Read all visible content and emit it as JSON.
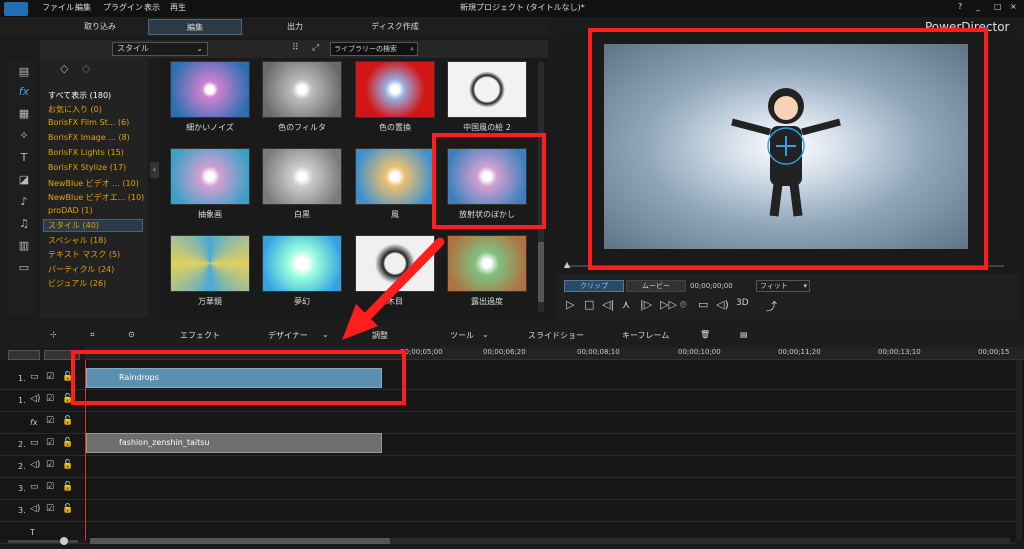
{
  "app": {
    "title": "新規プロジェクト (タイトルなし)*",
    "brand": "PowerDirector"
  },
  "menu": [
    "ファイル",
    "編集",
    "プラグイン",
    "表示",
    "再生"
  ],
  "window_controls": [
    "?",
    "_",
    "□",
    "×"
  ],
  "main_tabs": [
    "取り込み",
    "編集",
    "出力",
    "ディスク作成"
  ],
  "library": {
    "dropdown": "スタイル",
    "search_placeholder": "ライブラリーの検索"
  },
  "categories": [
    {
      "label": "すべて表示 (180)",
      "color": "#ffffff"
    },
    {
      "label": "お気に入り (0)"
    },
    {
      "label": "BorisFX Film St... (6)"
    },
    {
      "label": "BorisFX Image ... (8)"
    },
    {
      "label": "BorisFX Lights (15)"
    },
    {
      "label": "BorisFX Stylize (17)"
    },
    {
      "label": "NewBlue ビデオ ... (10)"
    },
    {
      "label": "NewBlue ビデオエ... (10)"
    },
    {
      "label": "proDAD (1)"
    },
    {
      "label": "スタイル (40)",
      "selected": true
    },
    {
      "label": "スペシャル (18)"
    },
    {
      "label": "テキスト マスク (5)"
    },
    {
      "label": "パーティクル (24)"
    },
    {
      "label": "ビジュアル (26)"
    }
  ],
  "effects": [
    {
      "label": "細かいノイズ",
      "bg": "#2a6fb0"
    },
    {
      "label": "色のフィルタ",
      "bg": "#6a6a6a"
    },
    {
      "label": "色の置換",
      "bg": "#d21515"
    },
    {
      "label": "中国風の絵 2",
      "bg": "#f2f2f2"
    },
    {
      "label": "抽象画",
      "bg": "#3aa0c8"
    },
    {
      "label": "白黒",
      "bg": "#7a7a7a"
    },
    {
      "label": "風",
      "bg": "#3c8fd0"
    },
    {
      "label": "放射状のぼかし",
      "bg": "#3d7fc0"
    },
    {
      "label": "万華鏡",
      "bg": "#4aa8d8"
    },
    {
      "label": "夢幻",
      "bg": "#35a2e0"
    },
    {
      "label": "木目",
      "bg": "#f0f0f0"
    },
    {
      "label": "露出過度",
      "bg": "#b07040"
    }
  ],
  "preview_controls": {
    "clip": "クリップ",
    "movie": "ムービー",
    "timecode": "00;00;00;00",
    "fit": "フィット",
    "mode3d": "3D"
  },
  "timeline_toolbar": [
    "エフェクト",
    "デザイナー",
    "調整",
    "ツール",
    "スライドショー",
    "キーフレーム"
  ],
  "ruler_ticks": [
    "00;00;05;00",
    "00;00;06;20",
    "00;00;08;10",
    "00;00;10;00",
    "00;00;11;20",
    "00;00;13;10",
    "00;00;15"
  ],
  "tracks": [
    {
      "label": "1."
    },
    {
      "label": "1."
    },
    {
      "label": "fx"
    },
    {
      "label": "2."
    },
    {
      "label": "2."
    },
    {
      "label": "3."
    },
    {
      "label": "3."
    },
    {
      "label": "T"
    }
  ],
  "clips": {
    "raindrops": "Raindrops",
    "fashion": "fashion_zenshin_taitsu"
  }
}
